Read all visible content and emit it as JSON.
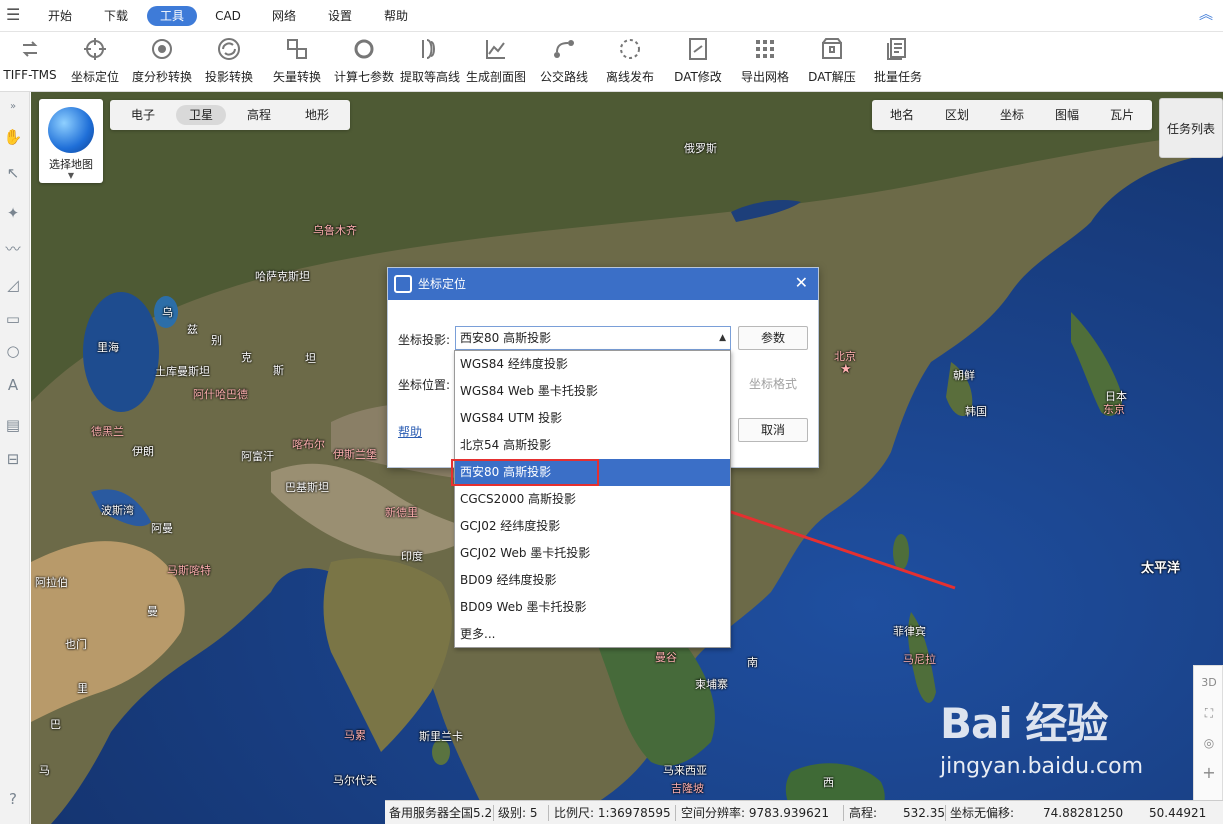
{
  "menu": {
    "items": [
      "开始",
      "下载",
      "工具",
      "CAD",
      "网络",
      "设置",
      "帮助"
    ],
    "active": "工具"
  },
  "toolbar": {
    "tools": [
      {
        "label": "TIFF-TMS",
        "icon": "tiff-tms-icon"
      },
      {
        "label": "坐标定位",
        "icon": "crosshair-icon"
      },
      {
        "label": "度分秒转换",
        "icon": "dms-convert-icon"
      },
      {
        "label": "投影转换",
        "icon": "projection-convert-icon"
      },
      {
        "label": "矢量转换",
        "icon": "vector-convert-icon"
      },
      {
        "label": "计算七参数",
        "icon": "seven-params-icon"
      },
      {
        "label": "提取等高线",
        "icon": "contour-icon"
      },
      {
        "label": "生成剖面图",
        "icon": "profile-chart-icon"
      },
      {
        "label": "公交路线",
        "icon": "bus-route-icon"
      },
      {
        "label": "离线发布",
        "icon": "offline-publish-icon"
      },
      {
        "label": "DAT修改",
        "icon": "dat-edit-icon"
      },
      {
        "label": "导出网格",
        "icon": "grid-export-icon"
      },
      {
        "label": "DAT解压",
        "icon": "dat-unzip-icon"
      },
      {
        "label": "批量任务",
        "icon": "batch-task-icon"
      }
    ]
  },
  "map_chooser": {
    "label": "选择地图"
  },
  "map_types": [
    "电子",
    "卫星",
    "高程",
    "地形"
  ],
  "map_types_active": "卫星",
  "layers": [
    "地名",
    "区划",
    "坐标",
    "图幅",
    "瓦片"
  ],
  "task_list": "任务列表",
  "right_controls": {
    "mode_3d": "3D"
  },
  "map_labels": [
    {
      "text": "俄罗斯",
      "pink": false
    },
    {
      "text": "乌鲁木齐",
      "pink": true
    },
    {
      "text": "哈萨克斯坦",
      "pink": false
    },
    {
      "text": "里海",
      "pink": false
    },
    {
      "text": "乌",
      "pink": false
    },
    {
      "text": "兹",
      "pink": false
    },
    {
      "text": "别",
      "pink": false
    },
    {
      "text": "克",
      "pink": false
    },
    {
      "text": "斯",
      "pink": false
    },
    {
      "text": "坦",
      "pink": false
    },
    {
      "text": "土库曼斯坦",
      "pink": false
    },
    {
      "text": "阿什哈巴德",
      "pink": true
    },
    {
      "text": "德黑兰",
      "pink": true
    },
    {
      "text": "伊朗",
      "pink": false
    },
    {
      "text": "阿富汗",
      "pink": false
    },
    {
      "text": "喀布尔",
      "pink": true
    },
    {
      "text": "伊斯兰堡",
      "pink": true
    },
    {
      "text": "巴基斯坦",
      "pink": false
    },
    {
      "text": "新德里",
      "pink": true
    },
    {
      "text": "波斯湾",
      "pink": false
    },
    {
      "text": "阿曼",
      "pink": false
    },
    {
      "text": "马斯喀特",
      "pink": true
    },
    {
      "text": "阿拉伯",
      "pink": false
    },
    {
      "text": "曼",
      "pink": false
    },
    {
      "text": "也门",
      "pink": false
    },
    {
      "text": "印度",
      "pink": false
    },
    {
      "text": "斯里兰卡",
      "pink": false
    },
    {
      "text": "马尔代夫",
      "pink": false
    },
    {
      "text": "马累",
      "pink": true
    },
    {
      "text": "北京",
      "pink": true
    },
    {
      "text": "朝鲜",
      "pink": false
    },
    {
      "text": "韩国",
      "pink": false
    },
    {
      "text": "日本",
      "pink": false
    },
    {
      "text": "东京",
      "pink": true
    },
    {
      "text": "太平洋",
      "pink": false
    },
    {
      "text": "菲律宾",
      "pink": false
    },
    {
      "text": "马尼拉",
      "pink": true
    },
    {
      "text": "柬埔寨",
      "pink": false
    },
    {
      "text": "南",
      "pink": false
    },
    {
      "text": "曼谷",
      "pink": true
    },
    {
      "text": "马来西亚",
      "pink": false
    },
    {
      "text": "吉隆坡",
      "pink": true
    },
    {
      "text": "西",
      "pink": false
    },
    {
      "text": "巴",
      "pink": false
    },
    {
      "text": "里",
      "pink": false
    },
    {
      "text": "马",
      "pink": false
    }
  ],
  "dialog": {
    "title": "坐标定位",
    "projection_label": "坐标投影:",
    "projection_value": "西安80 高斯投影",
    "position_label": "坐标位置:",
    "params_button": "参数",
    "format_button": "坐标格式",
    "cancel_button": "取消",
    "help_link": "帮助"
  },
  "dropdown": {
    "options": [
      "WGS84 经纬度投影",
      "WGS84 Web 墨卡托投影",
      "WGS84 UTM 投影",
      "北京54 高斯投影",
      "西安80 高斯投影",
      "CGCS2000 高斯投影",
      "GCJ02 经纬度投影",
      "GCJ02 Web 墨卡托投影",
      "BD09 经纬度投影",
      "BD09 Web 墨卡托投影",
      "更多..."
    ],
    "selected_index": 4
  },
  "status": {
    "server": "备用服务器全国5.2",
    "level": "级别:  5",
    "scale": "比例尺: 1:36978595",
    "resolution": "空间分辨率: 9783.939621",
    "elevation_label": "高程:",
    "elevation_value": "532.35",
    "coord_label": "坐标无偏移:",
    "lon": "74.88281250",
    "lat": "50.44921"
  },
  "watermark": {
    "logo": "Bai 经验",
    "url": "jingyan.baidu.com"
  },
  "colors": {
    "accent": "#3b6fc7",
    "highlight": "#e53030"
  }
}
